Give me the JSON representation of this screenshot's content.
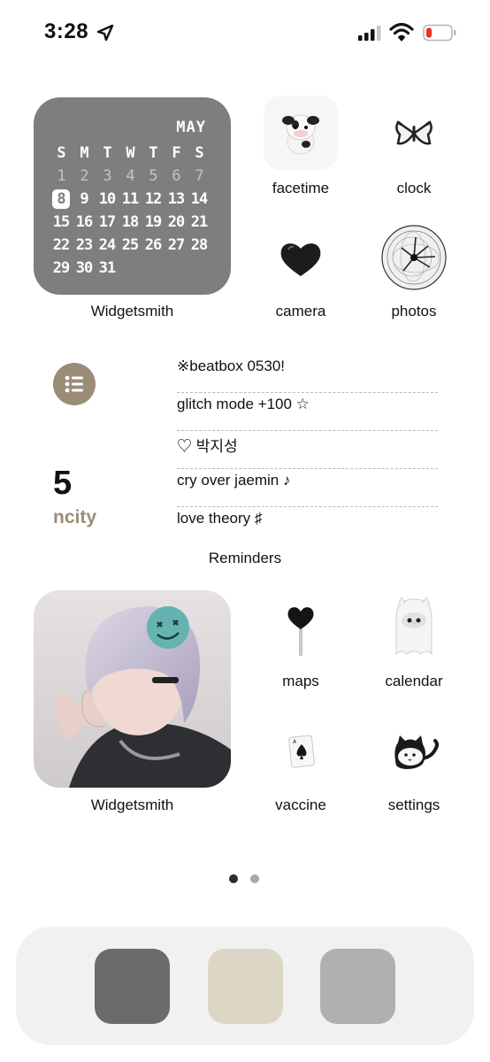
{
  "status_bar": {
    "time": "3:28",
    "icons": [
      "location-arrow-icon",
      "cellular-signal-icon",
      "wifi-icon",
      "battery-low-icon"
    ],
    "battery_color": "#e5332a"
  },
  "calendar_widget": {
    "month": "MAY",
    "weekdays": [
      "S",
      "M",
      "T",
      "W",
      "T",
      "F",
      "S"
    ],
    "weeks": [
      [
        "1",
        "2",
        "3",
        "4",
        "5",
        "6",
        "7"
      ],
      [
        "8",
        "9",
        "10",
        "11",
        "12",
        "13",
        "14"
      ],
      [
        "15",
        "16",
        "17",
        "18",
        "19",
        "20",
        "21"
      ],
      [
        "22",
        "23",
        "24",
        "25",
        "26",
        "27",
        "28"
      ],
      [
        "29",
        "30",
        "31"
      ]
    ],
    "today": "8",
    "label": "Widgetsmith",
    "background": "#7e7e7e"
  },
  "apps_top": [
    {
      "label": "facetime",
      "icon": "cow-plush-icon"
    },
    {
      "label": "clock",
      "icon": "butterfly-icon"
    },
    {
      "label": "camera",
      "icon": "black-heart-icon"
    },
    {
      "label": "photos",
      "icon": "dandelion-sphere-icon"
    }
  ],
  "reminders_widget": {
    "count": "5",
    "list_name": "ncity",
    "accent": "#9a8d78",
    "items": [
      "※beatbox 0530!",
      "glitch mode +100 ☆",
      "♡ 박지성",
      "cry over jaemin ♪",
      "love theory ♯"
    ],
    "label": "Reminders"
  },
  "photo_widget": {
    "label": "Widgetsmith"
  },
  "apps_bottom": [
    {
      "label": "maps",
      "icon": "heart-lollipop-icon"
    },
    {
      "label": "calendar",
      "icon": "ghost-icon"
    },
    {
      "label": "vaccine",
      "icon": "ace-of-spades-card-icon"
    },
    {
      "label": "settings",
      "icon": "cat-icon"
    }
  ],
  "page_dots": {
    "count": 2,
    "active": 1
  },
  "dock": {
    "apps": [
      {
        "name": "dock-app-1",
        "color": "#6b6b6b"
      },
      {
        "name": "dock-app-2",
        "color": "#dcd6c6"
      },
      {
        "name": "dock-app-3",
        "color": "#b0b0b0"
      }
    ]
  }
}
